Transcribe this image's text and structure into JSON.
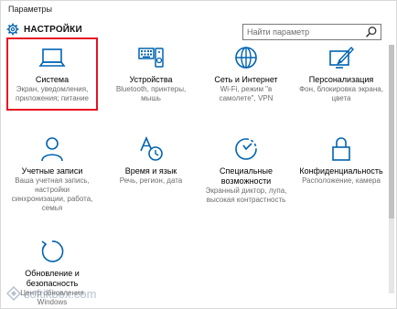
{
  "window": {
    "title": "Параметры"
  },
  "header": {
    "title": "НАСТРОЙКИ",
    "icon": "gear-icon"
  },
  "search": {
    "placeholder": "Найти параметр",
    "icon": "search-icon"
  },
  "accent_color": "#0063b1",
  "selection_color": "#e81123",
  "tiles": [
    {
      "name": "Система",
      "desc": "Экран, уведомления, приложения; питание",
      "icon": "laptop-icon"
    },
    {
      "name": "Устройства",
      "desc": "Bluetooth, принтеры, мышь",
      "icon": "devices-icon"
    },
    {
      "name": "Сеть и Интернет",
      "desc": "Wi-Fi, режим \"в самолете\", VPN",
      "icon": "globe-icon"
    },
    {
      "name": "Персонализация",
      "desc": "Фон, блокировка экрана, цвета",
      "icon": "personalization-icon"
    },
    {
      "name": "Учетные записи",
      "desc": "Ваша учетная запись, настройки синхронизации, работа, семья",
      "icon": "user-icon"
    },
    {
      "name": "Время и язык",
      "desc": "Речь, регион, дата",
      "icon": "time-language-icon"
    },
    {
      "name": "Специальные возможности",
      "desc": "Экранный диктор, лупа, высокая контрастность",
      "icon": "accessibility-icon"
    },
    {
      "name": "Конфиденциальность",
      "desc": "Расположение, камера",
      "icon": "lock-icon"
    },
    {
      "name": "Обновление и безопасность",
      "desc": "Центр обновления Windows",
      "icon": "update-icon"
    }
  ],
  "watermark": {
    "text": "softikbox.com"
  }
}
